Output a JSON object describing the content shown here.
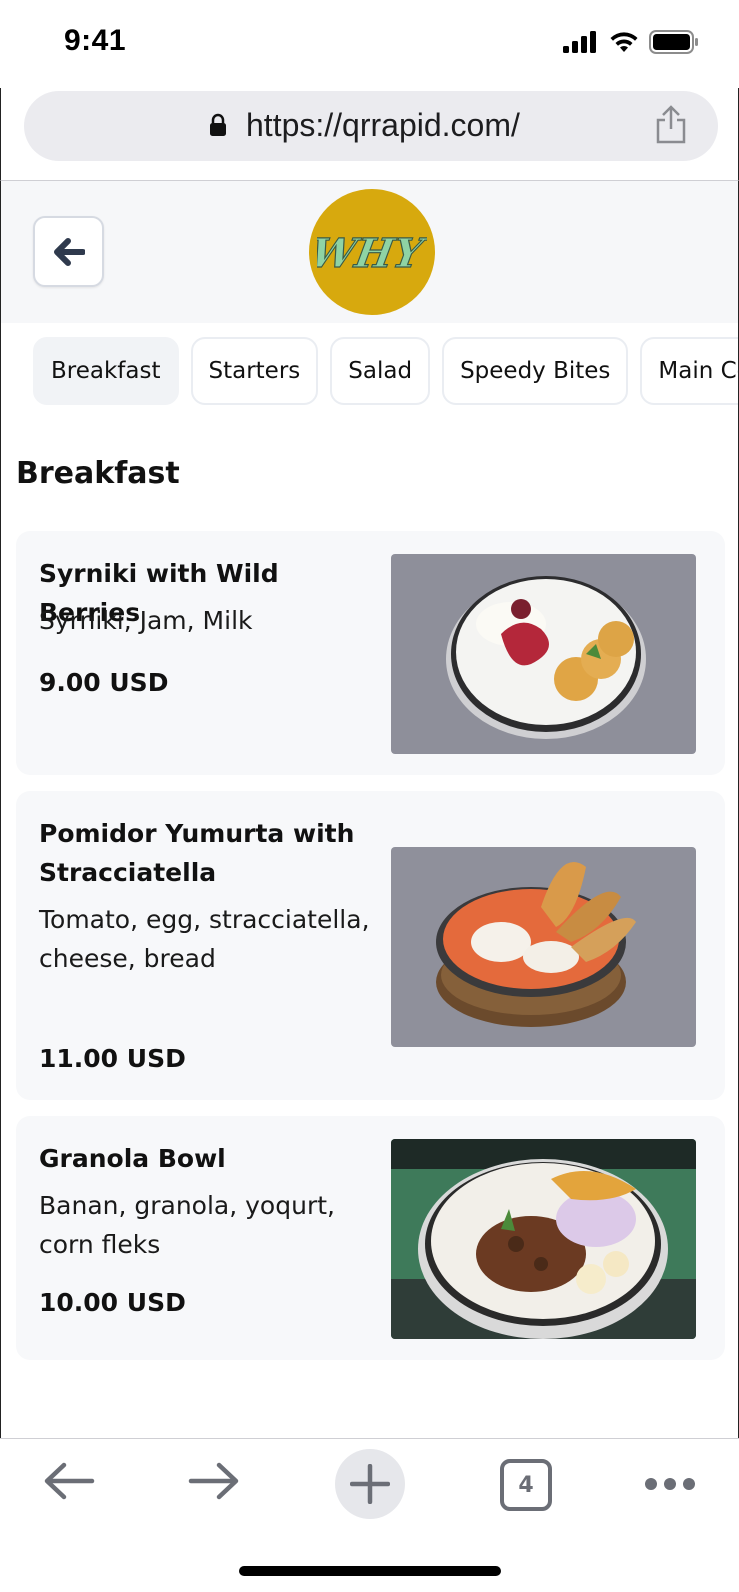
{
  "status_bar": {
    "time": "9:41"
  },
  "browser": {
    "url": "https://qrrapid.com/",
    "tab_count": "4"
  },
  "header": {
    "logo_text": "WHY"
  },
  "categories": [
    "Breakfast",
    "Starters",
    "Salad",
    "Speedy Bites",
    "Main Co"
  ],
  "section_title": "Breakfast",
  "items": [
    {
      "name": "Syrniki with Wild Berries",
      "description": "Syrniki, Jam, Milk",
      "price": "9.00 USD"
    },
    {
      "name": "Pomidor Yumurta with Stracciatella",
      "description": "Tomato, egg, stracciatella, cheese, bread",
      "price": "11.00 USD"
    },
    {
      "name": "Granola Bowl",
      "description": "Banan, granola, yoqurt, corn fleks",
      "price": "10.00 USD"
    }
  ],
  "colors": {
    "logo_bg": "#d7a90e",
    "logo_text": "#8fd3a4",
    "card_bg": "#f7f8fa"
  }
}
